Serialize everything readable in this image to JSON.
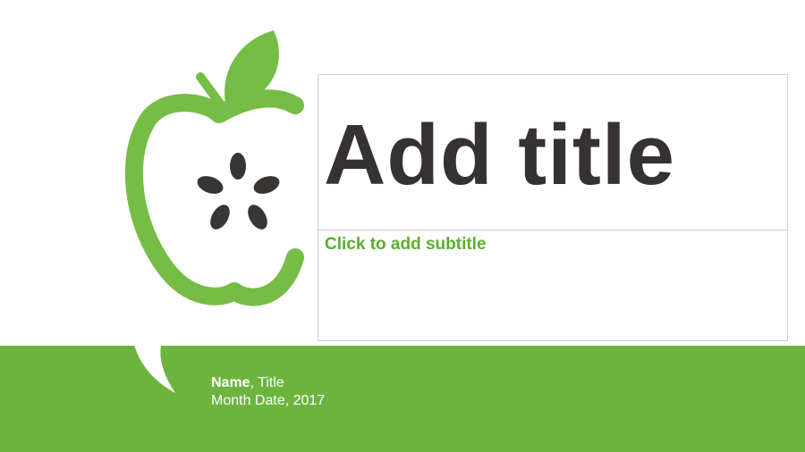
{
  "slide": {
    "title_placeholder": "Add title",
    "subtitle_placeholder": "Click to add subtitle",
    "footer": {
      "name": "Name",
      "title_suffix": ", Title",
      "date": "Month Date, 2017"
    }
  },
  "colors": {
    "brand_green": "#6db43f",
    "subtitle_green": "#5cae2e",
    "title_dark": "#353231",
    "seed_dark": "#383635"
  },
  "icons": [
    "apple-logo-icon",
    "apple-seed-icon",
    "apple-leaf-icon",
    "speech-bubble-tail-icon"
  ]
}
